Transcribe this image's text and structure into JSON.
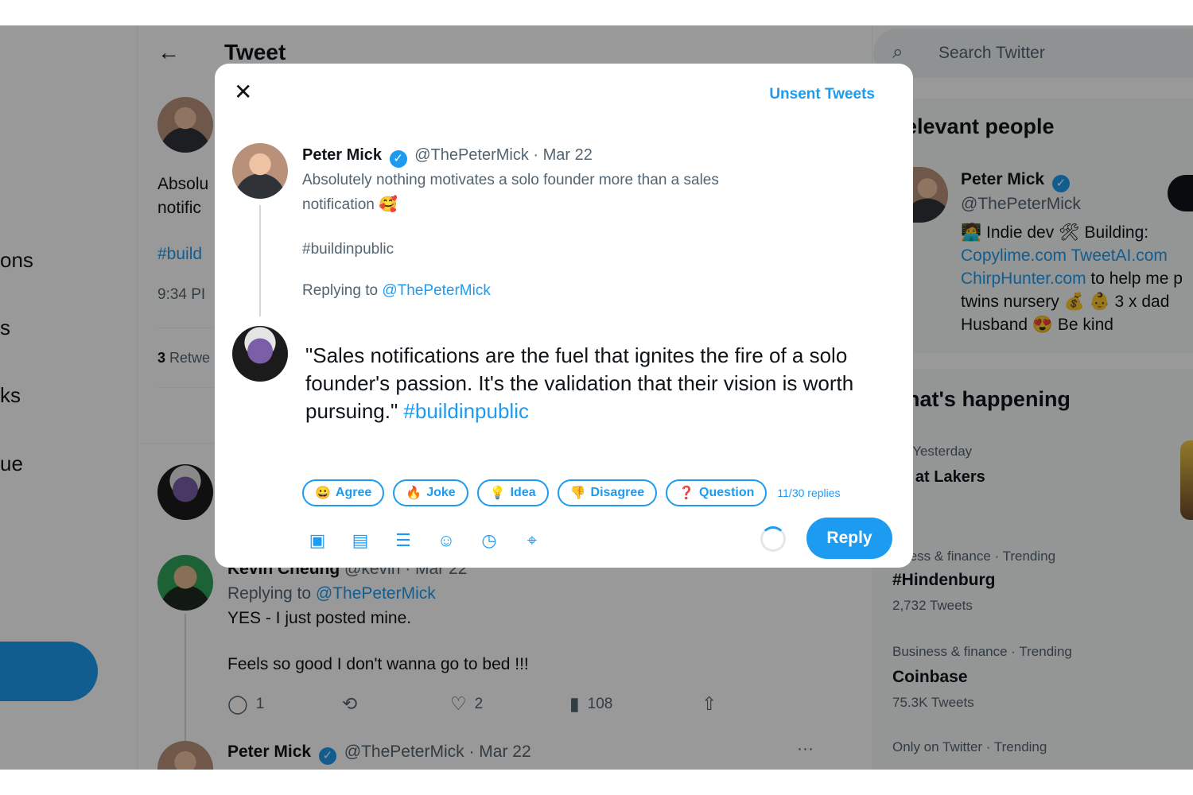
{
  "nav": {
    "items": [
      {
        "label": "ons"
      },
      {
        "label": "s"
      },
      {
        "label": "ks"
      },
      {
        "label": "ue"
      }
    ]
  },
  "header": {
    "back_icon": "arrow-left-icon",
    "title": "Tweet"
  },
  "main_tweet": {
    "text_line1": "Absolu",
    "text_line2": "notific",
    "hashtag": "#build",
    "time": "9:34 PI",
    "retweets": "3",
    "retweets_label": "Retwe"
  },
  "thread": {
    "reply1": {
      "name_partial": "Kevin Cheung",
      "handle_date": "@kevin · Mar 22",
      "replying_prefix": "Replying to",
      "replying_handle": "@ThePeterMick",
      "line1": "YES - I just posted mine.",
      "line2": "Feels so good I don't wanna go to bed !!!",
      "actions": {
        "replies": "1",
        "retweets": "",
        "likes": "2",
        "views": "108"
      }
    },
    "reply2": {
      "name": "Peter Mick",
      "handle_date": "@ThePeterMick · Mar 22",
      "more": "···"
    }
  },
  "sidebar": {
    "search_placeholder": "Search Twitter",
    "relevant": {
      "title": "elevant people",
      "name": "Peter Mick",
      "handle": "@ThePeterMick",
      "bio1": "🧑‍💻 Indie dev 🛠 Building:",
      "bio_link1": "Copylime.com TweetAI.com",
      "bio_link2": "ChirpHunter.com",
      "bio2_rest": " to help me p",
      "bio3": "twins nursery 💰 👶 3 x dad",
      "bio4": "Husband 😍 Be kind"
    },
    "happening": {
      "title": "hat's happening",
      "trends": [
        {
          "context": "A · Yesterday",
          "name": "ns at Lakers",
          "count": ""
        },
        {
          "context": "siness & finance · Trending",
          "name": "#Hindenburg",
          "count": "2,732 Tweets"
        },
        {
          "context": "Business & finance · Trending",
          "name": "Coinbase",
          "count": "75.3K Tweets"
        },
        {
          "context": "Only on Twitter · Trending",
          "name": "",
          "count": ""
        }
      ]
    }
  },
  "modal": {
    "close_icon": "close-icon",
    "unsent_label": "Unsent Tweets",
    "original": {
      "name": "Peter Mick",
      "handle_date": "@ThePeterMick · Mar 22",
      "line1": "Absolutely nothing motivates a solo founder more than a sales",
      "line2": "notification 🥰",
      "hashtag": "#buildinpublic",
      "replying_prefix": "Replying to",
      "replying_handle": "@ThePeterMick"
    },
    "reply_text": "\"Sales notifications are the fuel that ignites the fire of a solo founder's passion. It's the validation that their vision is worth pursuing.\"",
    "reply_hashtag": "#buildinpublic",
    "chips": [
      {
        "emoji": "😀",
        "label": "Agree"
      },
      {
        "emoji": "🔥",
        "label": "Joke"
      },
      {
        "emoji": "💡",
        "label": "Idea"
      },
      {
        "emoji": "👎",
        "label": "Disagree"
      },
      {
        "emoji": "❓",
        "label": "Question"
      }
    ],
    "counter": "11/30 replies",
    "tools": [
      "image-icon",
      "gif-icon",
      "poll-icon",
      "emoji-icon",
      "schedule-icon",
      "location-icon"
    ],
    "reply_button": "Reply"
  },
  "colors": {
    "accent": "#1d9bf0",
    "text": "#0f1419",
    "muted": "#536471",
    "overlay": "rgba(0,0,0,0.4)"
  }
}
